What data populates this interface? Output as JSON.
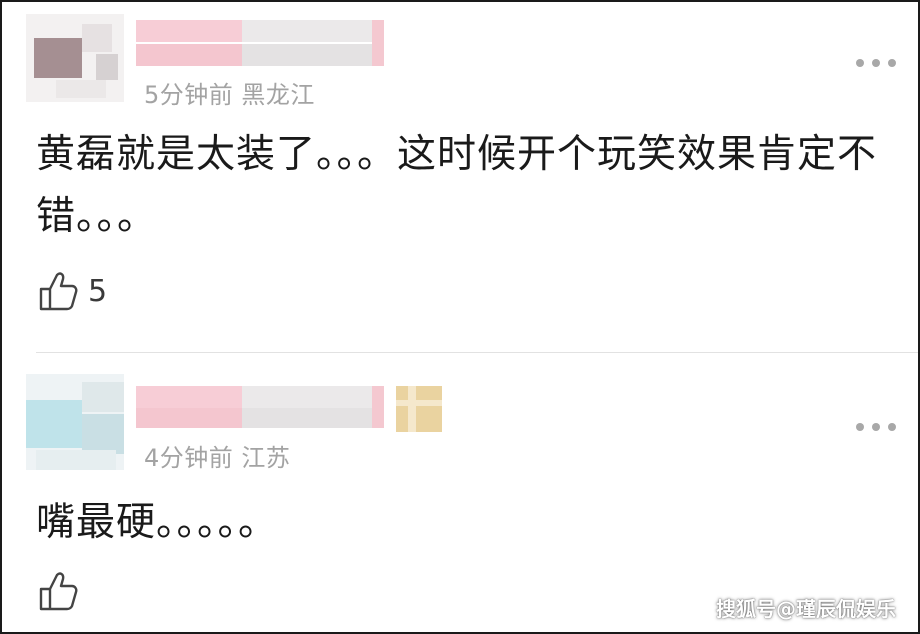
{
  "comments": [
    {
      "meta": "5分钟前 黑龙江",
      "text": "黄磊就是太装了。。。这时候开个玩笑效果肯定不错。。。",
      "likes": "5"
    },
    {
      "meta": "4分钟前 江苏",
      "text": "嘴最硬。。。。。",
      "likes": ""
    }
  ],
  "icons": {
    "more": "more-dots-icon",
    "like": "thumbs-up-icon"
  },
  "watermark": "搜狐号@瑾辰侃娱乐",
  "colors": {
    "meta_text": "#a3a3a3",
    "body_text": "#1a1a1a",
    "blur_pink": "#f4c6cf",
    "blur_gray": "#e2e2e2",
    "blur_tan": "#ead3a0"
  }
}
